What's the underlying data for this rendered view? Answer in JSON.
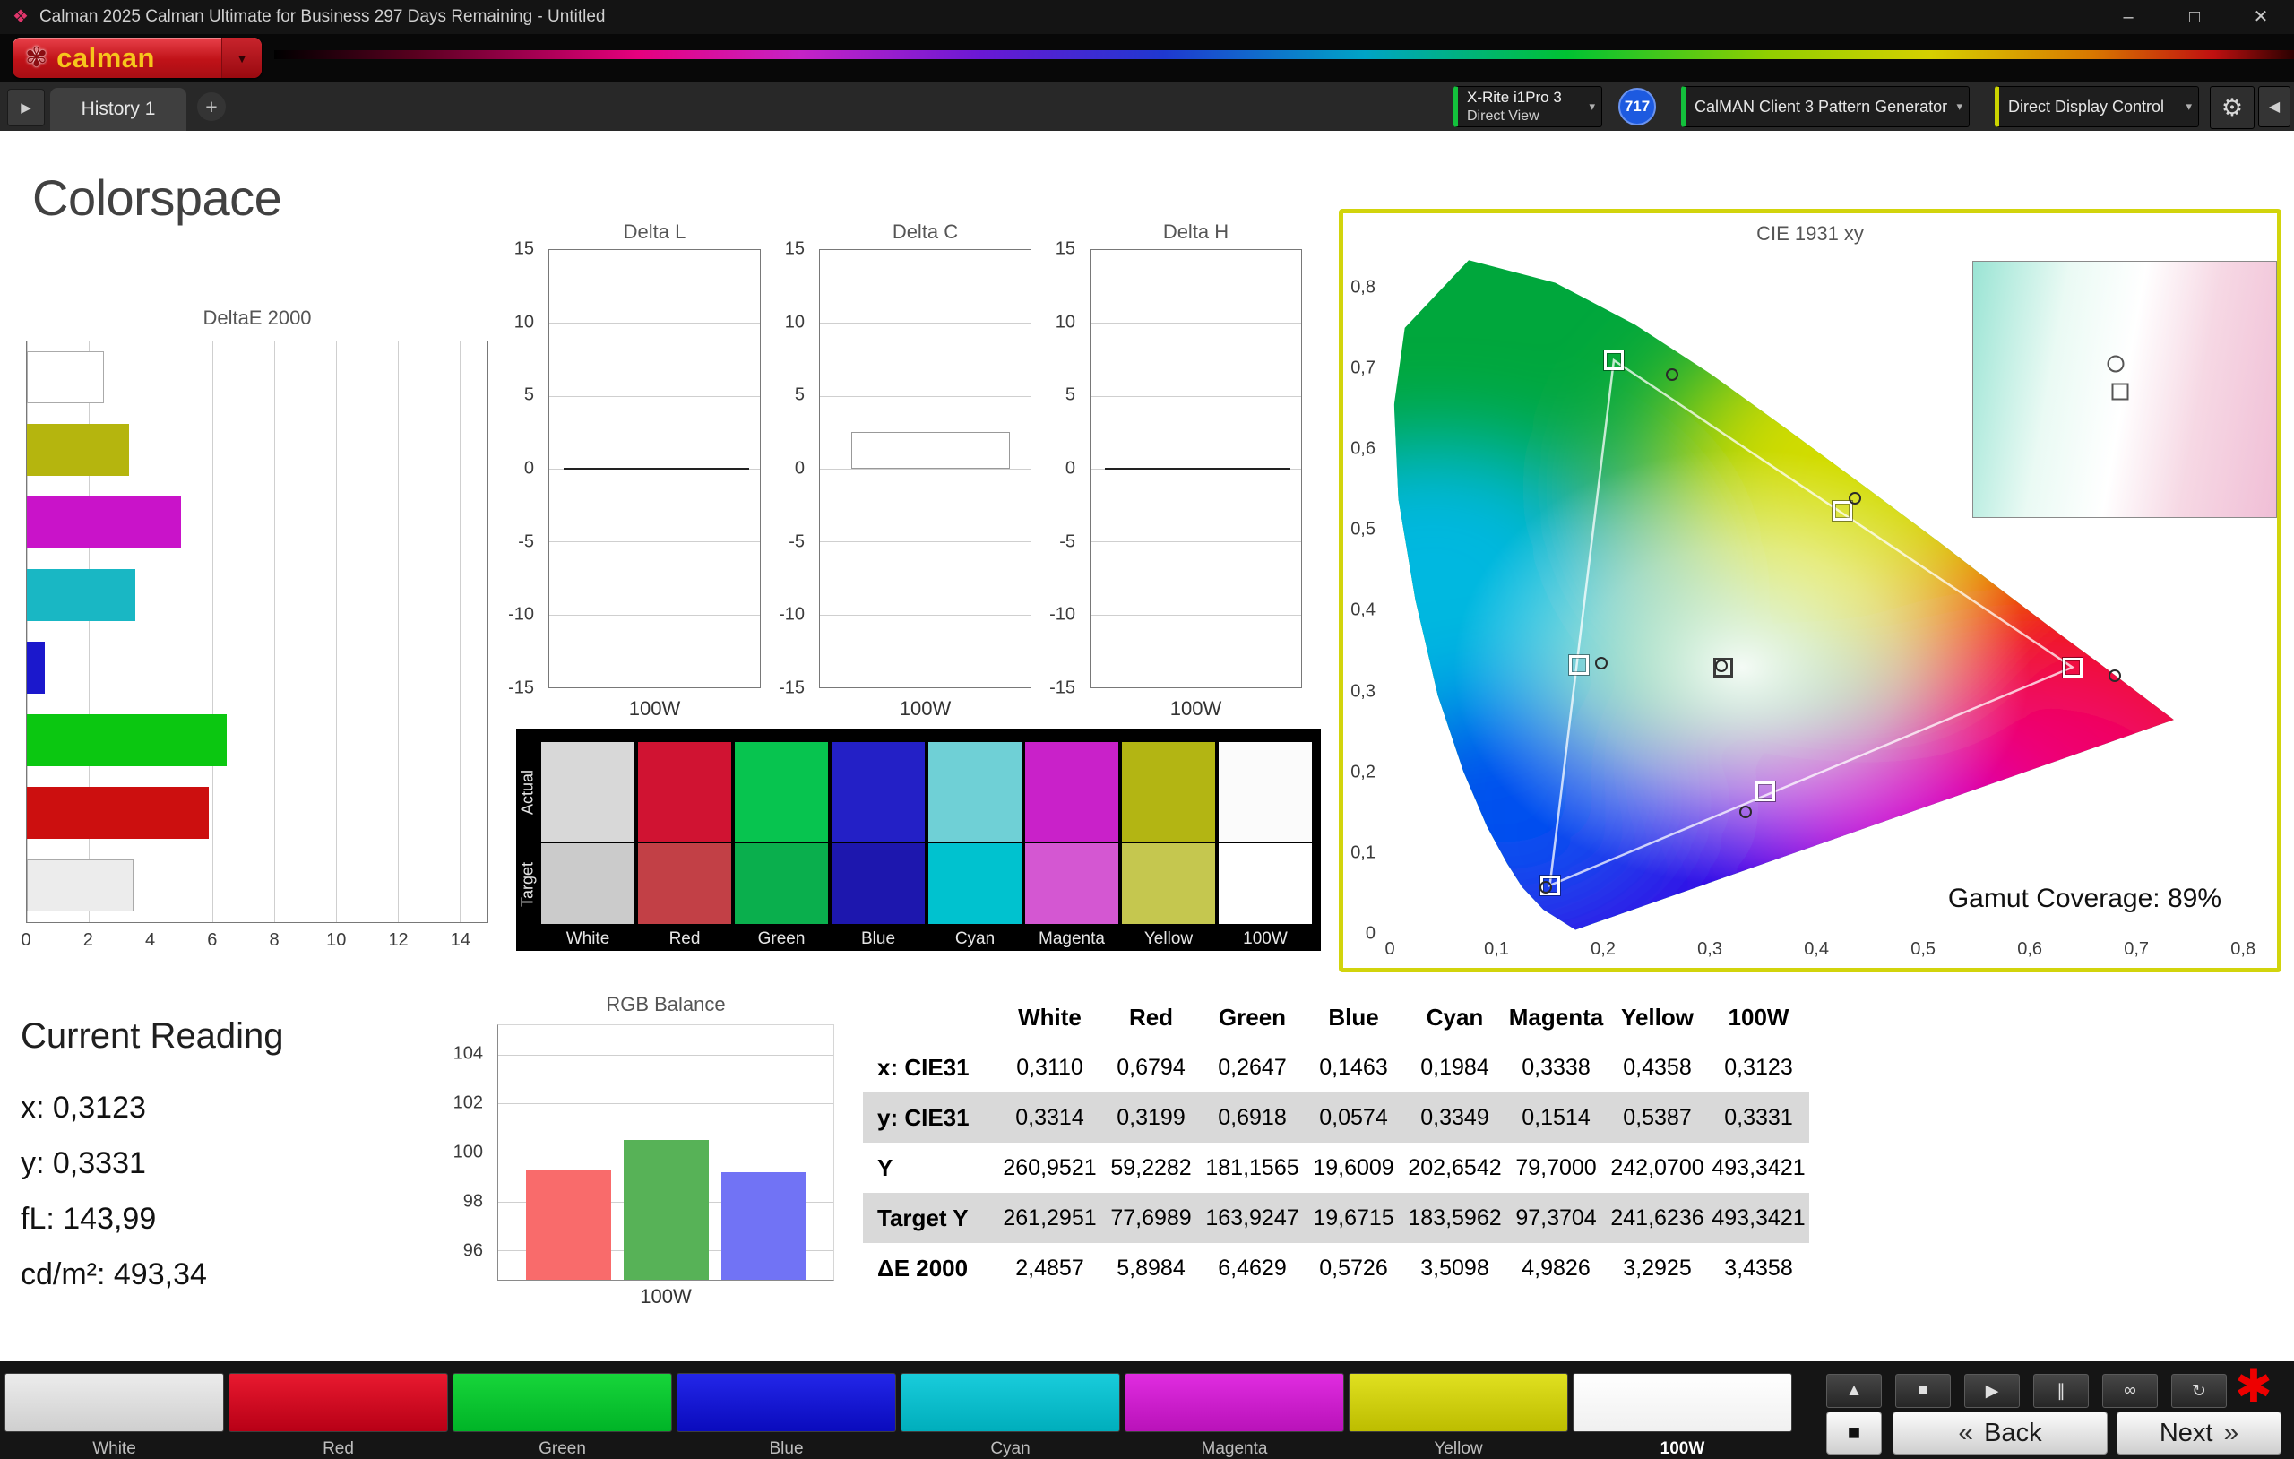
{
  "window": {
    "title": "Calman 2025 Calman Ultimate for Business 297 Days Remaining  - Untitled"
  },
  "icons": {
    "title_diamond": "❖",
    "logo_flower": "✾",
    "caret_down": "▾",
    "caret_down_solid": "▼",
    "minimize": "–",
    "maximize": "□",
    "close": "✕",
    "panel_arrow": "▶",
    "plus": "+",
    "gear": "⚙",
    "collapse_left": "◀"
  },
  "brand": {
    "logo_text": "calman"
  },
  "tab_bar": {
    "history_tab": "History 1"
  },
  "device_bar": {
    "meter_line1": "X-Rite i1Pro 3",
    "meter_line2": "Direct View",
    "meter_badge": "717",
    "pattern_generator": "CalMAN Client 3 Pattern Generator",
    "display_control": "Direct Display Control"
  },
  "page": {
    "title": "Colorspace"
  },
  "chart_data": [
    {
      "id": "deltae2000",
      "type": "bar",
      "orientation": "horizontal",
      "title": "DeltaE 2000",
      "categories": [
        "White",
        "Yellow",
        "Magenta",
        "Cyan",
        "Blue",
        "Green",
        "Red",
        "100W"
      ],
      "values": [
        2.4857,
        3.2925,
        4.9826,
        3.5098,
        0.5726,
        6.4629,
        5.8984,
        3.4358
      ],
      "colors": [
        "#ffffff",
        "#b5b50e",
        "#c913c9",
        "#19b7c4",
        "#1b18cc",
        "#0bc711",
        "#cc0f0f",
        "#ececec"
      ],
      "borders": [
        "#aaaaaa",
        null,
        null,
        null,
        null,
        null,
        null,
        "#aaaaaa"
      ],
      "xlim": [
        0,
        14.9
      ],
      "x_ticks": [
        0,
        2,
        4,
        6,
        8,
        10,
        12,
        14
      ]
    },
    {
      "id": "delta_l",
      "type": "bar",
      "title": "Delta L",
      "categories": [
        "100W"
      ],
      "values": [
        0
      ],
      "ylim": [
        -15,
        15
      ],
      "y_ticks": [
        15,
        10,
        5,
        0,
        -5,
        -10,
        -15
      ],
      "xlabel": "100W"
    },
    {
      "id": "delta_c",
      "type": "bar",
      "title": "Delta C",
      "categories": [
        "100W"
      ],
      "values": [
        2.5
      ],
      "ylim": [
        -15,
        15
      ],
      "y_ticks": [
        15,
        10,
        5,
        0,
        -5,
        -10,
        -15
      ],
      "xlabel": "100W",
      "bar_color": "#ffffff",
      "bar_border": "#999999"
    },
    {
      "id": "delta_h",
      "type": "bar",
      "title": "Delta H",
      "categories": [
        "100W"
      ],
      "values": [
        0
      ],
      "ylim": [
        -15,
        15
      ],
      "y_ticks": [
        15,
        10,
        5,
        0,
        -5,
        -10,
        -15
      ],
      "xlabel": "100W"
    },
    {
      "id": "rgb_balance",
      "type": "bar",
      "title": "RGB Balance",
      "categories": [
        "Red",
        "Green",
        "Blue"
      ],
      "values": [
        99.3,
        100.5,
        99.2
      ],
      "colors": [
        "#f96b6b",
        "#57b257",
        "#7173f5"
      ],
      "ylim": [
        94.8,
        105.2
      ],
      "y_ticks": [
        104,
        102,
        100,
        98,
        96
      ],
      "xlabel": "100W"
    }
  ],
  "cie": {
    "title": "CIE 1931 xy",
    "coverage_label": "Gamut Coverage:",
    "coverage_value": "89%",
    "x_tick_labels": [
      "0",
      "0,1",
      "0,2",
      "0,3",
      "0,4",
      "0,5",
      "0,6",
      "0,7",
      "0,8"
    ],
    "y_tick_labels": [
      "0",
      "0,1",
      "0,2",
      "0,3",
      "0,4",
      "0,5",
      "0,6",
      "0,7",
      "0,8"
    ],
    "x_range": [
      0,
      0.82
    ],
    "y_range": [
      0,
      0.842
    ],
    "triangle": [
      [
        0.64,
        0.33
      ],
      [
        0.21,
        0.71
      ],
      [
        0.15,
        0.06
      ]
    ],
    "target_names": [
      "white",
      "red",
      "green",
      "blue",
      "cyan",
      "magenta",
      "yellow"
    ],
    "targets": [
      [
        0.3127,
        0.329
      ],
      [
        0.64,
        0.33
      ],
      [
        0.21,
        0.71
      ],
      [
        0.15,
        0.06
      ],
      [
        0.177,
        0.333
      ],
      [
        0.352,
        0.176
      ],
      [
        0.424,
        0.524
      ]
    ],
    "measured": [
      [
        0.311,
        0.3314
      ],
      [
        0.6794,
        0.3199
      ],
      [
        0.2647,
        0.6918
      ],
      [
        0.1463,
        0.0574
      ],
      [
        0.1984,
        0.3349
      ],
      [
        0.3338,
        0.1514
      ],
      [
        0.4358,
        0.5387
      ]
    ]
  },
  "swatch_panel": {
    "row_labels": [
      "Actual",
      "Target"
    ],
    "columns": [
      {
        "label": "White",
        "actual": "#d8d8d8",
        "target": "#cbcbcb"
      },
      {
        "label": "Red",
        "actual": "#d01332",
        "target": "#c24046"
      },
      {
        "label": "Green",
        "actual": "#07c44f",
        "target": "#0aaf4d"
      },
      {
        "label": "Blue",
        "actual": "#2320c6",
        "target": "#1d17ae"
      },
      {
        "label": "Cyan",
        "actual": "#6fd0d6",
        "target": "#00c2cf"
      },
      {
        "label": "Magenta",
        "actual": "#c921c9",
        "target": "#d457d2"
      },
      {
        "label": "Yellow",
        "actual": "#b3b513",
        "target": "#c5c74f"
      },
      {
        "label": "100W",
        "actual": "#fbfbfb",
        "target": "#ffffff"
      }
    ]
  },
  "current_reading": {
    "title": "Current Reading",
    "lines": [
      "x: 0,3123",
      "y: 0,3331",
      "fL: 143,99",
      "cd/m²: 493,34"
    ]
  },
  "table": {
    "headers": [
      "",
      "White",
      "Red",
      "Green",
      "Blue",
      "Cyan",
      "Magenta",
      "Yellow",
      "100W"
    ],
    "rows": [
      {
        "label": "x: CIE31",
        "shaded": false,
        "values": [
          "0,3110",
          "0,6794",
          "0,2647",
          "0,1463",
          "0,1984",
          "0,3338",
          "0,4358",
          "0,3123"
        ]
      },
      {
        "label": "y: CIE31",
        "shaded": true,
        "values": [
          "0,3314",
          "0,3199",
          "0,6918",
          "0,0574",
          "0,3349",
          "0,1514",
          "0,5387",
          "0,3331"
        ]
      },
      {
        "label": "Y",
        "shaded": false,
        "values": [
          "260,9521",
          "59,2282",
          "181,1565",
          "19,6009",
          "202,6542",
          "79,7000",
          "242,0700",
          "493,3421"
        ]
      },
      {
        "label": "Target Y",
        "shaded": true,
        "values": [
          "261,2951",
          "77,6989",
          "163,9247",
          "19,6715",
          "183,5962",
          "97,3704",
          "241,6236",
          "493,3421"
        ]
      },
      {
        "label": "ΔE 2000",
        "shaded": false,
        "values": [
          "2,4857",
          "5,8984",
          "6,4629",
          "0,5726",
          "3,5098",
          "4,9826",
          "3,2925",
          "3,4358"
        ]
      }
    ]
  },
  "pattern_bar": {
    "buttons": [
      {
        "label": "White",
        "top": "#ececec",
        "bottom": "#cfcfcf"
      },
      {
        "label": "Red",
        "top": "#e8192f",
        "bottom": "#b80016"
      },
      {
        "label": "Green",
        "top": "#17d53a",
        "bottom": "#00b427"
      },
      {
        "label": "Blue",
        "top": "#2326e8",
        "bottom": "#0a0bbd"
      },
      {
        "label": "Cyan",
        "top": "#19ccdb",
        "bottom": "#00aebc"
      },
      {
        "label": "Magenta",
        "top": "#e02ce0",
        "bottom": "#b912b9"
      },
      {
        "label": "Yellow",
        "top": "#e0e020",
        "bottom": "#bdbd00"
      },
      {
        "label": "100W",
        "top": "#ffffff",
        "bottom": "#f0f0f0",
        "bold": true
      }
    ]
  },
  "transport": {
    "buttons": [
      {
        "name": "up",
        "glyph": "▲"
      },
      {
        "name": "stop",
        "glyph": "■"
      },
      {
        "name": "play",
        "glyph": "▶"
      },
      {
        "name": "pause",
        "glyph": "∥"
      },
      {
        "name": "continuous",
        "glyph": "∞"
      },
      {
        "name": "loop",
        "glyph": "↻"
      }
    ],
    "big_stop_glyph": "■",
    "back_label": "Back",
    "next_label": "Next",
    "back_chevron": "«",
    "next_chevron": "»",
    "alert_glyph": "✱"
  }
}
